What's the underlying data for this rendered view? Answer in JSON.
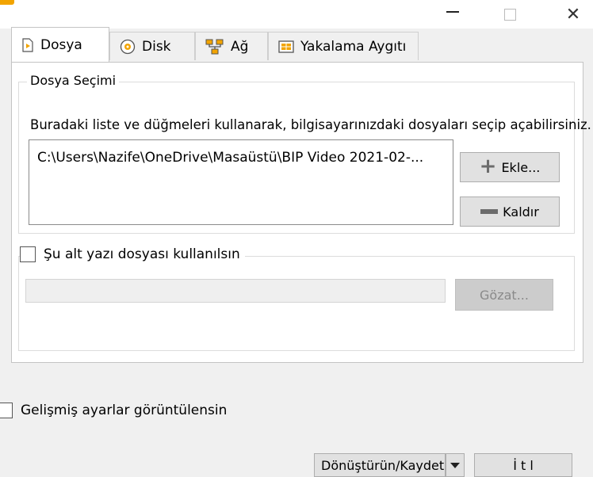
{
  "window": {
    "title": "",
    "minimize_icon": "minimize-icon",
    "maximize_icon": "maximize-icon",
    "close_icon": "close-icon",
    "close_glyph": "✕"
  },
  "tabs": [
    {
      "label": "Dosya",
      "icon": "file-icon",
      "active": true
    },
    {
      "label": "Disk",
      "icon": "disc-icon",
      "active": false
    },
    {
      "label": "Ağ",
      "icon": "network-icon",
      "active": false
    },
    {
      "label": "Yakalama Aygıtı",
      "icon": "capture-device-icon",
      "active": false
    }
  ],
  "file_selection": {
    "legend": "Dosya Seçimi",
    "description": "Buradaki liste ve düğmeleri kullanarak, bilgisayarınızdaki dosyaları seçip açabilirsiniz.",
    "files": [
      "C:\\Users\\Nazife\\OneDrive\\Masaüstü\\BIP Video 2021-02-..."
    ],
    "add_label": "Ekle...",
    "remove_label": "Kaldır"
  },
  "subtitle": {
    "checkbox_label": "Şu alt yazı dosyası kullanılsın",
    "checked": false,
    "path_value": "",
    "browse_label": "Gözat..."
  },
  "advanced": {
    "checkbox_label": "Gelişmiş ayarlar görüntülensin",
    "checked": false
  },
  "footer": {
    "convert_label": "Dönüştürün/Kaydet",
    "play_label": "İ t l"
  },
  "colors": {
    "accent_orange": "#f2a400",
    "disabled_button": "#cccccc"
  }
}
